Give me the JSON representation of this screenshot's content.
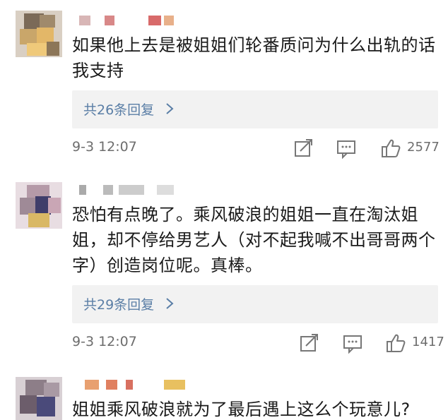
{
  "comments": [
    {
      "text_line1": "如果他上去是被姐姐们轮番质问为什么出轨的话",
      "text_line2": "我支持",
      "reply_label": "共26条回复",
      "time": "9-3 12:07",
      "likes": "2577",
      "icons": [
        "forward-icon",
        "comment-icon",
        "like-icon"
      ]
    },
    {
      "text_line1": "恐怕有点晚了。乘风破浪的姐姐一直在淘汰姐",
      "text_line2": "姐，却不停给男艺人（对不起我喊不出哥哥两个",
      "text_line3": "字）创造岗位呢。真棒。",
      "reply_label": "共29条回复",
      "time": "9-3 12:07",
      "likes": "1417",
      "icons": [
        "forward-icon",
        "comment-icon",
        "like-icon"
      ]
    },
    {
      "text_line1": "姐姐乘风破浪就为了最后遇上这么个玩意儿?"
    }
  ],
  "colors": {
    "link": "#5a7ea6",
    "meta": "#6d6d6d",
    "reply_bg": "#f2f2f2"
  }
}
